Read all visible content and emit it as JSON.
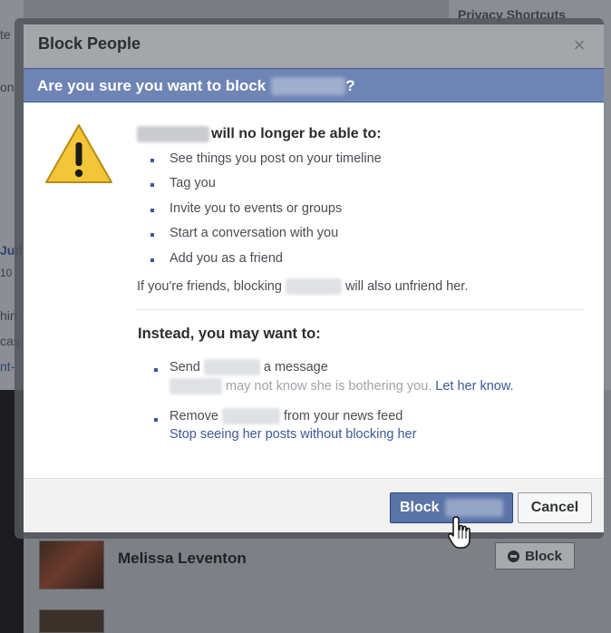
{
  "background": {
    "topright_text": "Privacy  Shortcuts",
    "left_fragments": [
      "te",
      "on",
      "Jud",
      "10",
      "hin",
      "cas",
      "nt-"
    ],
    "list_row": {
      "name": "Melissa Leventon",
      "block_label": "Block"
    }
  },
  "dialog": {
    "title": "Block People",
    "question_prefix": "Are you sure you want to block",
    "question_suffix": "?",
    "headline": "will no longer be able to:",
    "bullets": [
      "See things you post on your timeline",
      "Tag you",
      "Invite you to events or groups",
      "Start a conversation with you",
      "Add you as a friend"
    ],
    "friends_note_prefix": "If you're friends, blocking",
    "friends_note_suffix": "will also unfriend her.",
    "instead_heading": "Instead, you may want to:",
    "option_send": {
      "label_prefix": "Send",
      "label_suffix": "a message",
      "detail": "may not know she is bothering you.",
      "link": "Let her know."
    },
    "option_remove": {
      "label_prefix": "Remove",
      "label_suffix": "from your news feed",
      "link": "Stop seeing her posts without blocking her"
    },
    "block_button": "Block",
    "cancel_button": "Cancel"
  },
  "colors": {
    "question_bar": "#6d84b4",
    "link": "#3b5998",
    "primary_button": "#5b74a8"
  }
}
